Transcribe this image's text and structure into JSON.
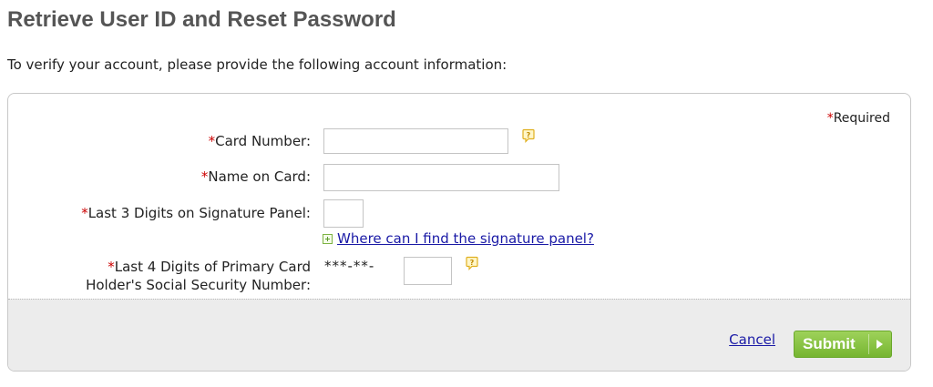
{
  "page": {
    "title": "Retrieve User ID and Reset Password",
    "intro": "To verify your account, please provide the following account information:"
  },
  "form": {
    "required_star": "*",
    "required_note": "Required",
    "fields": {
      "card_number": {
        "label": "Card Number:",
        "value": "",
        "help_icon": "question-speech-bubble-icon"
      },
      "name_on_card": {
        "label": "Name on Card:",
        "value": ""
      },
      "signature_digits": {
        "label": "Last 3 Digits on Signature Panel:",
        "value": "",
        "link_icon": "expand-plus-icon",
        "link_text": "Where can I find the signature panel?"
      },
      "ssn_digits": {
        "label_line1": "Last 4 Digits of Primary Card",
        "label_line2": "Holder's Social Security Number:",
        "prefix": "***-**-",
        "value": "",
        "help_icon": "question-speech-bubble-icon"
      }
    },
    "actions": {
      "cancel_label": "Cancel",
      "submit_label": "Submit",
      "submit_icon": "play-arrow-icon"
    }
  },
  "colors": {
    "title": "#555555",
    "required_star": "#cc0000",
    "link": "#1a1aa6",
    "submit_button": "#8cc63f",
    "footer_bg": "#ececec",
    "help_icon": "#e0b020"
  }
}
